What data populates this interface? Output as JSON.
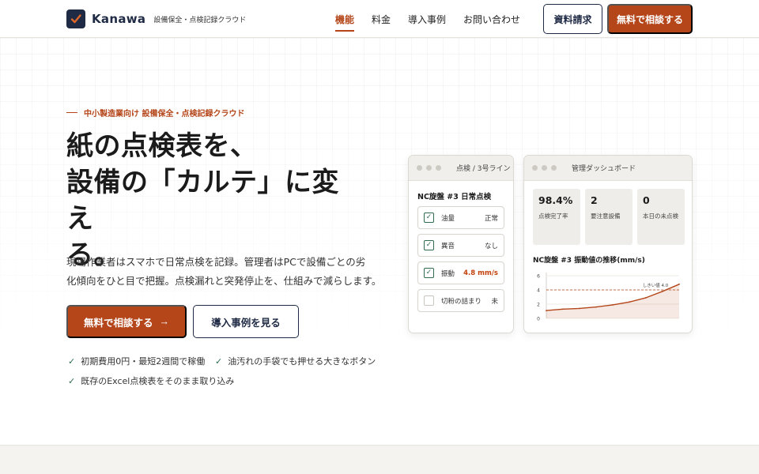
{
  "brand": {
    "name": "Kanawa",
    "tagline": "設備保全・点検記録クラウド",
    "accent": "#b4461a",
    "navy": "#1f2a44"
  },
  "nav": {
    "items": [
      "機能",
      "料金",
      "導入事例",
      "お問い合わせ"
    ],
    "active": "機能",
    "request_docs": "資料請求",
    "consult": "無料で相談する"
  },
  "hero": {
    "eyebrow": "中小製造業向け 設備保全・点検記録クラウド",
    "title_line1": "紙の点検表を、",
    "title_line2": "設備の「カルテ」に変え",
    "title_line3": "る。",
    "desc_line1": "現場作業者はスマホで日常点検を記録。管理者はPCで設備ごとの劣",
    "desc_line2": "化傾向をひと目で把握。点検漏れと突発停止を、仕組みで減らします。",
    "cta_primary": "無料で相談する",
    "cta_arrow": "→",
    "cta_secondary": "導入事例を見る",
    "features": [
      "初期費用0円・最短2週間で稼働",
      "油汚れの手袋でも押せる大きなボタン",
      "既存のExcel点検表をそのまま取り込み"
    ]
  },
  "inspection_card": {
    "window_title": "点検 / 3号ライン",
    "heading": "NC旋盤 #3 日常点検",
    "items": [
      {
        "label": "油量",
        "value": "正常",
        "checked": true,
        "warn": false
      },
      {
        "label": "異音",
        "value": "なし",
        "checked": true,
        "warn": false
      },
      {
        "label": "振動",
        "value": "4.8 mm/s",
        "checked": true,
        "warn": true
      },
      {
        "label": "切粉の詰まり",
        "value": "未",
        "checked": false,
        "warn": false
      }
    ]
  },
  "dashboard_card": {
    "window_title": "管理ダッシュボード",
    "stats": [
      {
        "value": "98.4%",
        "label": "点検完了率"
      },
      {
        "value": "2",
        "label": "要注意設備"
      },
      {
        "value": "0",
        "label": "本日の未点検"
      }
    ],
    "chart_title": "NC旋盤 #3 振動値の推移(mm/s)"
  },
  "chart_data": {
    "type": "area",
    "title": "NC旋盤 #3 振動値の推移(mm/s)",
    "x": [
      0,
      1,
      2,
      3,
      4,
      5,
      6,
      7,
      8
    ],
    "y": [
      1.1,
      1.3,
      1.4,
      1.6,
      1.9,
      2.3,
      2.9,
      3.8,
      4.8
    ],
    "ylim": [
      0,
      6
    ],
    "yticks": [
      "0",
      "2",
      "4",
      "6"
    ],
    "threshold": {
      "value": 4.0,
      "label": "しきい値 4.0"
    },
    "line_color": "#b4461a",
    "grid": true
  }
}
